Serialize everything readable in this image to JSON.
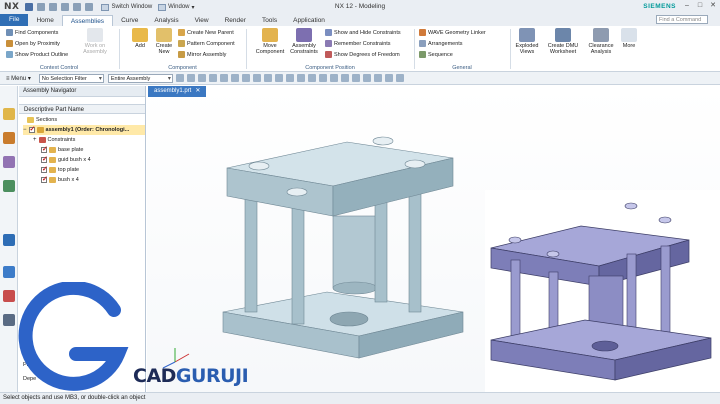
{
  "titlebar": {
    "logo": "NX",
    "switch_window": "Switch Window",
    "window_menu": "Window",
    "title": "NX 12 - Modeling",
    "brand": "SIEMENS",
    "search_placeholder": "Find a Command"
  },
  "tabs": [
    "File",
    "Home",
    "Assemblies",
    "Curve",
    "Analysis",
    "View",
    "Render",
    "Tools",
    "Application"
  ],
  "active_tab": "Assemblies",
  "ribbon": {
    "context_control": {
      "label": "Context Control",
      "items": [
        "Find Components",
        "Open by Proximity",
        "Show Product Outline"
      ],
      "disabled_btn": "Work on Assembly"
    },
    "component": {
      "label": "Component",
      "add": "Add",
      "create_new": "Create New",
      "items": [
        "Create New Parent",
        "Pattern Component",
        "Mirror Assembly"
      ]
    },
    "component_position": {
      "label": "Component Position",
      "move": "Move Component",
      "constraints": "Assembly Constraints",
      "items": [
        "Show and Hide Constraints",
        "Remember Constraints",
        "Show Degrees of Freedom"
      ]
    },
    "general": {
      "label": "General",
      "items": [
        "WAVE Geometry Linker",
        "Arrangements",
        "Sequence"
      ]
    },
    "exploded": "Exploded Views",
    "dmu": "Create DMU Worksheet",
    "clearance": "Clearance Analysis",
    "more": "More"
  },
  "cmdbar": {
    "menu": "Menu",
    "filter": "No Selection Filter",
    "scope": "Entire Assembly"
  },
  "navigator": {
    "title": "Assembly Navigator",
    "column": "Descriptive Part Name",
    "rows": [
      {
        "label": "Sections",
        "indent": 0
      },
      {
        "label": "assembly1 (Order: Chronologi...",
        "indent": 0
      },
      {
        "label": "Constraints",
        "indent": 1
      },
      {
        "label": "base plate",
        "indent": 1
      },
      {
        "label": "guid bush x 4",
        "indent": 1
      },
      {
        "label": "top plate",
        "indent": 1
      },
      {
        "label": "bush x 4",
        "indent": 1
      }
    ],
    "bottom_labels": [
      "Prev",
      "Depe"
    ]
  },
  "doc_tab": "assembly1.prt",
  "status_text": "Select objects and use MB3, or double-click an object",
  "watermark": {
    "letter": "G",
    "text_main": "CAD",
    "text_accent": "GURUJI"
  },
  "colors": {
    "accent": "#2f6eb5",
    "model": "#b9cfd8",
    "model_inset": "#8f90c8",
    "siemens": "#009999"
  }
}
